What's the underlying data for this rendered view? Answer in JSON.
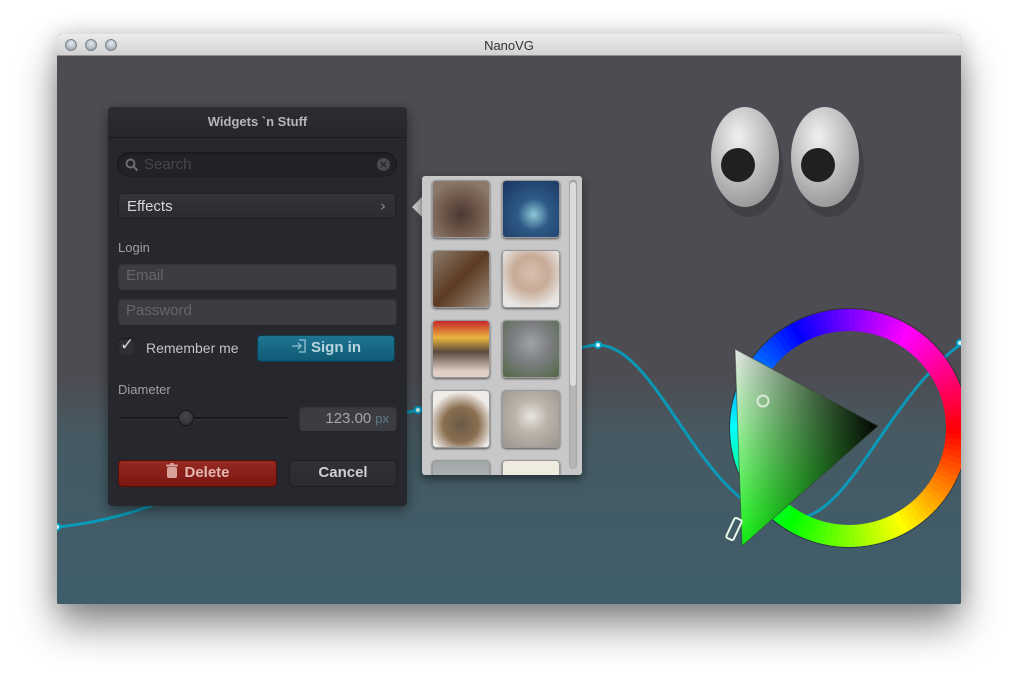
{
  "window": {
    "title": "NanoVG",
    "traffic_lights": [
      "close-button",
      "minimize-button",
      "zoom-button"
    ]
  },
  "panel": {
    "title": "Widgets `n Stuff",
    "search": {
      "placeholder": "Search",
      "value": "",
      "icon": "search-icon",
      "clear_icon": "clear-icon"
    },
    "dropdown": {
      "label": "Effects",
      "icon": "chevron-right-icon"
    },
    "login_label": "Login",
    "email": {
      "placeholder": "Email",
      "value": ""
    },
    "password": {
      "placeholder": "Password",
      "value": ""
    },
    "remember": {
      "label": "Remember me",
      "checked": true
    },
    "signin_label": "Sign in",
    "diameter_label": "Diameter",
    "slider": {
      "value_fraction": 0.4
    },
    "number": {
      "value": "123.00",
      "unit": "px"
    },
    "delete_label": "Delete",
    "cancel_label": "Cancel"
  },
  "thumbnails": {
    "items": [
      {
        "name": "dog"
      },
      {
        "name": "jellyfish"
      },
      {
        "name": "shrew"
      },
      {
        "name": "bunny"
      },
      {
        "name": "cat"
      },
      {
        "name": "baby-animal"
      },
      {
        "name": "tortoise"
      },
      {
        "name": "mouse"
      },
      {
        "name": "partial-1"
      },
      {
        "name": "partial-2"
      }
    ],
    "scroll_fraction": 0.0
  },
  "colorwheel": {
    "hue_degrees": 120,
    "selected_color": "#4dd64d"
  },
  "colors": {
    "accent_blue": "#0f6a88",
    "delete_red": "#8a1e17",
    "curve": "#00a5c8",
    "background_top": "#4d4c52",
    "background_bottom": "#3e5e6b"
  }
}
